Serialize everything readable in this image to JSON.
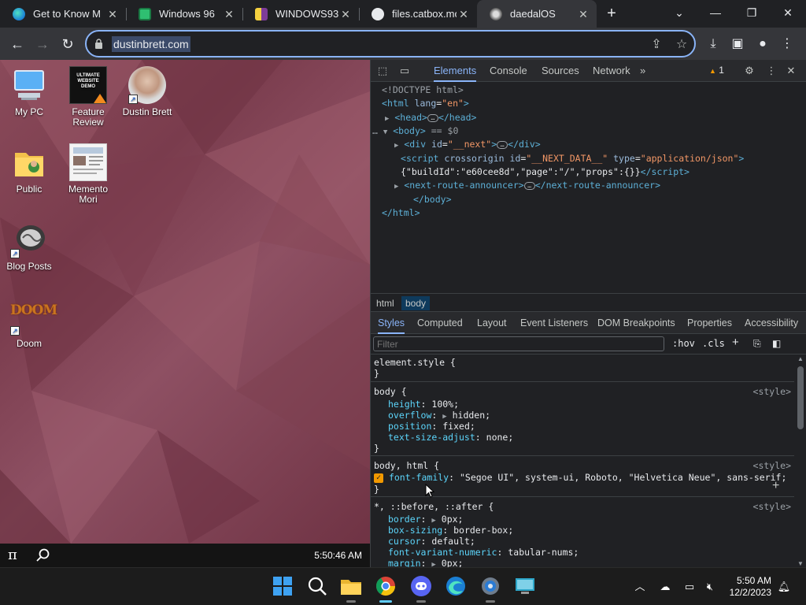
{
  "browser": {
    "tabs": [
      {
        "title": "Get to Know M",
        "favicon": "edge-icon",
        "active": false
      },
      {
        "title": "Windows 96",
        "favicon": "windows96-icon",
        "active": false
      },
      {
        "title": "WINDOWS93",
        "favicon": "windows93-icon",
        "active": false
      },
      {
        "title": "files.catbox.mo",
        "favicon": "catbox-icon",
        "active": false
      },
      {
        "title": "daedalOS",
        "favicon": "daedalos-icon",
        "active": true
      }
    ],
    "url": "dustinbrett.com"
  },
  "desktop": {
    "icons": [
      {
        "label": "My PC",
        "icon": "computer-icon"
      },
      {
        "label": "Feature Review",
        "icon": "video-thumbnail-icon",
        "thumb_text": "ULTIMATE WEBSITE DEMO"
      },
      {
        "label": "Dustin Brett",
        "icon": "profile-photo-icon"
      },
      {
        "label": "Public",
        "icon": "folder-icon"
      },
      {
        "label": "Memento Mori",
        "icon": "document-thumbnail-icon"
      },
      {
        "label": "Blog Posts",
        "icon": "brain-icon"
      },
      {
        "label": "Doom",
        "icon": "doom-icon",
        "logo_text": "DOOM"
      }
    ],
    "taskbar": {
      "start_glyph": "π",
      "clock": "5:50:46 AM"
    }
  },
  "devtools": {
    "tabs": [
      "Elements",
      "Console",
      "Sources",
      "Network"
    ],
    "active_tab": "Elements",
    "more": "»",
    "warnings": "1",
    "dom": {
      "doctype": "<!DOCTYPE html>",
      "html_open_tag": "html",
      "html_attr": "lang",
      "html_attr_val": "\"en\"",
      "head_tag": "head",
      "body_tag": "body",
      "body_marker": "== $0",
      "div_tag": "div",
      "div_attr": "id",
      "div_val": "\"__next\"",
      "script_tag": "script",
      "script_attr1": "crossorigin",
      "script_attr2": "id",
      "script_val2": "\"__NEXT_DATA__\"",
      "script_attr3": "type",
      "script_val3": "\"application/json\"",
      "script_text": "{\"buildId\":\"e60cee8d\",\"page\":\"/\",\"props\":{}}",
      "announcer_tag": "next-route-announcer"
    },
    "breadcrumbs": [
      "html",
      "body"
    ],
    "subtabs": [
      "Styles",
      "Computed",
      "Layout",
      "Event Listeners",
      "DOM Breakpoints",
      "Properties",
      "Accessibility"
    ],
    "filter_placeholder": "Filter",
    "hov": ":hov",
    "cls": ".cls",
    "rules": [
      {
        "selector": "element.style {",
        "source": "",
        "props": []
      },
      {
        "selector": "body {",
        "source": "<style>",
        "props": [
          {
            "name": "height",
            "value": "100%;"
          },
          {
            "name": "overflow",
            "value": "hidden;",
            "expand": true
          },
          {
            "name": "position",
            "value": "fixed;"
          },
          {
            "name": "text-size-adjust",
            "value": "none;"
          }
        ]
      },
      {
        "selector": "body, html {",
        "source": "<style>",
        "props": [
          {
            "name": "font-family",
            "value": "\"Segoe UI\", system-ui, Roboto, \"Helvetica Neue\", sans-serif;",
            "checked": true
          }
        ]
      },
      {
        "selector": "*, ::before, ::after {",
        "source": "<style>",
        "props": [
          {
            "name": "border",
            "value": "0px;",
            "expand": true
          },
          {
            "name": "box-sizing",
            "value": "border-box;"
          },
          {
            "name": "cursor",
            "value": "default;"
          },
          {
            "name": "font-variant-numeric",
            "value": "tabular-nums;"
          },
          {
            "name": "margin",
            "value": "0px;",
            "expand": true
          }
        ]
      }
    ],
    "close_brace": "}"
  },
  "os_taskbar": {
    "apps": [
      "windows-start-icon",
      "search-icon",
      "file-explorer-icon",
      "chrome-icon",
      "discord-icon",
      "edge-icon",
      "settings-icon",
      "remote-desktop-icon"
    ],
    "time": "5:50 AM",
    "date": "12/2/2023"
  }
}
